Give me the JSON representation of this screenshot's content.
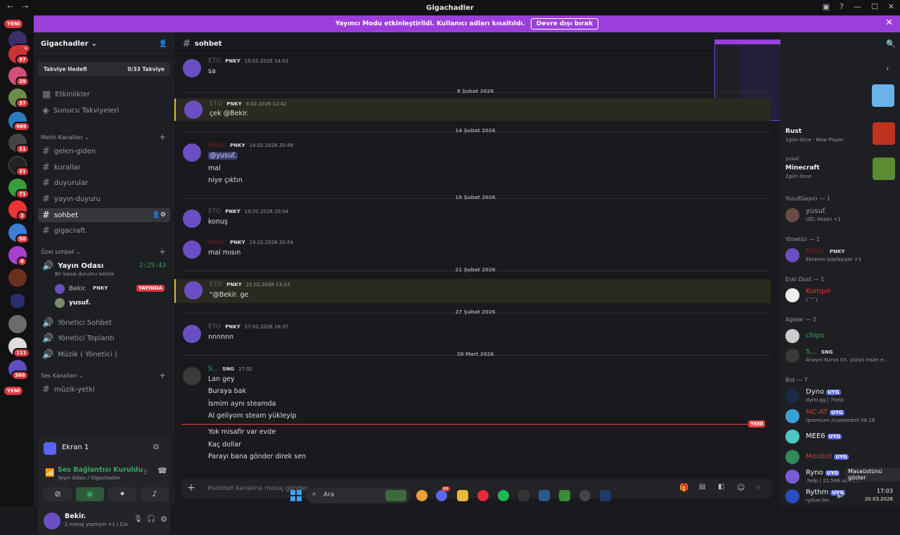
{
  "window": {
    "title": "Gigachadler"
  },
  "banner": {
    "text": "Yayıncı Modu etkinleştirildi. Kullanıcı adları kısaltıldı.",
    "button": "Devre dışı bırak"
  },
  "guilds": {
    "yeni_top": "YENİ",
    "yeni_bottom": "YENİ",
    "badges": [
      "1K+",
      "37",
      "20",
      "37",
      "969",
      "11",
      "31",
      "71",
      "3",
      "50",
      "8",
      "111",
      "368"
    ]
  },
  "server": {
    "name": "Gigachadler",
    "boost_label": "Takviye Hedefi",
    "boost_value": "0/33 Takviye"
  },
  "nav": {
    "events": "Etkinlikler",
    "boosts": "Sunucu Takviyeleri"
  },
  "categories": {
    "text": "Metin Kanalları",
    "private": "Özel sohbet",
    "voice": "Ses Kanalları"
  },
  "channels": [
    "gelen-giden",
    "kurallar",
    "duyurular",
    "yayın-duyuru",
    "sohbet",
    "gigacraft"
  ],
  "voice_channel": {
    "name": "Yayın Odası",
    "timer": "2:25:43",
    "status": "Bir kanal durumu belirle",
    "users": [
      {
        "name": "Bekir.",
        "tag": "PNKY",
        "live": "YAYINDA"
      },
      {
        "name": "yusuf."
      }
    ]
  },
  "private_channels": [
    "Yönetici Sohbet",
    "Yönetici Toplantı",
    "Müzik ( Yönetici )"
  ],
  "voice_channels": [
    "müzik-yetki"
  ],
  "voicebox": {
    "screen": "Ekran 1",
    "status": "Ses Bağlantısı Kuruldu",
    "location": "Yayın Odası / Gigachadler"
  },
  "user": {
    "name": "Bekir.",
    "status": "2 mesaj yazılıyor +1 / Cumartesi"
  },
  "chat": {
    "channel": "sohbet",
    "input_placeholder": "#sohbet kanalına mesaj gönder",
    "new_label": "YENİ",
    "messages": [
      {
        "author": "ETO",
        "tag": "PNKY",
        "time": "19.01.2026 14:03",
        "lines": [
          "sa"
        ]
      },
      {
        "divider": "8 Şubat 2026"
      },
      {
        "author": "ETO",
        "tag": "PNKY",
        "time": "8.02.2026 12:42",
        "lines": [
          "çek @Bekir."
        ]
      },
      {
        "divider": "14 Şubat 2026"
      },
      {
        "author": "Bekir.",
        "tag": "PNKY",
        "time": "14.02.2026 20:49",
        "lines": [
          "@yusuf.",
          "mal",
          "niye çıktın"
        ]
      },
      {
        "divider": "19 Şubat 2026"
      },
      {
        "author": "ETO",
        "tag": "PNKY",
        "time": "19.02.2026 20:54",
        "lines": [
          "konuş"
        ]
      },
      {
        "author": "Bekir.",
        "tag": "PNKY",
        "time": "19.02.2026 20:54",
        "lines": [
          "mal mısın"
        ]
      },
      {
        "divider": "21 Şubat 2026"
      },
      {
        "author": "ETO",
        "tag": "PNKY",
        "time": "21.02.2026 13:23",
        "lines": [
          "\"@Bekir. ge"
        ]
      },
      {
        "divider": "27 Şubat 2026"
      },
      {
        "author": "ETO",
        "tag": "PNKY",
        "time": "27.02.2026 16:37",
        "lines": [
          "nnnnnn"
        ]
      },
      {
        "divider": "20 Mart 2026"
      },
      {
        "author": "S...",
        "tag": "SNG",
        "time": "17:02",
        "lines": [
          "Lan gey",
          "Buraya bak",
          "İsmim aynı steamda",
          "Al geliyom steam yükleyip",
          "Yok misafir var evde",
          "Kaç dollar",
          "Parayı bana gönder direk sen"
        ]
      }
    ]
  },
  "members": {
    "activity": [
      {
        "game": "Rust",
        "meta": "1gün önce",
        "extra": "New Player"
      },
      {
        "user": "yusuf.",
        "game": "Minecraft",
        "meta": "2gün önce"
      }
    ],
    "groups": [
      {
        "title": "YusufGayıcı — 1",
        "members": [
          {
            "name": "yusuf.",
            "status": "UZL Aksan +1"
          }
        ]
      },
      {
        "title": "Yönetici — 1",
        "members": [
          {
            "name": "Bekir.",
            "tag": "PNKY",
            "status": "Ekranını paylaşıyor +1"
          }
        ]
      },
      {
        "title": "Eski Dost — 1",
        "members": [
          {
            "name": "Kumpir",
            "status": "( ̄︶ ̄)"
          }
        ]
      },
      {
        "title": "Agalar — 2",
        "members": [
          {
            "name": "chips",
            "status": ""
          },
          {
            "name": "S...",
            "tag": "SNG",
            "status": "Anayın Kurva XX. yüzyıl insan e..."
          }
        ]
      },
      {
        "title": "Bot — 7",
        "members": [
          {
            "name": "Dyno",
            "tag": "UYG",
            "status": "dyno.gg | ?help"
          },
          {
            "name": "MC-AT",
            "tag": "UYG",
            "status": "/premium /custombot V8.18"
          },
          {
            "name": "MEE6",
            "tag": "UYG",
            "status": ""
          },
          {
            "name": "Moobot",
            "tag": "UYG",
            "status": ""
          },
          {
            "name": "Ryno",
            "tag": "UYG",
            "status": ".help | 22,596 servers"
          },
          {
            "name": "Rythm",
            "tag": "UYG",
            "status": "rythm.fm"
          }
        ]
      }
    ]
  },
  "taskbar": {
    "search": "Ara",
    "time": "17:03",
    "date": "20.03.2026",
    "show_desktop": "Masaüstünü göster",
    "notif_count": "99"
  }
}
